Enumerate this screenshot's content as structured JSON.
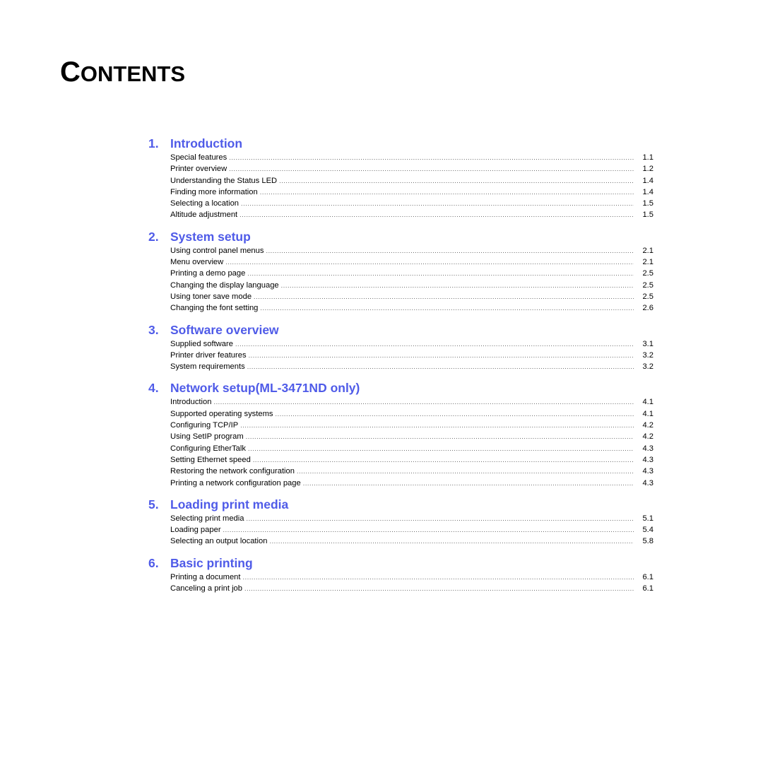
{
  "title": {
    "first_letter": "C",
    "rest": "ONTENTS"
  },
  "colors": {
    "section_heading": "#4f5be8",
    "text": "#000000"
  },
  "sections": [
    {
      "number": "1.",
      "title": "Introduction",
      "entries": [
        {
          "label": "Special features",
          "page": "1.1"
        },
        {
          "label": "Printer overview",
          "page": "1.2"
        },
        {
          "label": "Understanding the Status LED",
          "page": "1.4"
        },
        {
          "label": "Finding more information",
          "page": "1.4"
        },
        {
          "label": "Selecting a location",
          "page": "1.5"
        },
        {
          "label": "Altitude adjustment",
          "page": "1.5"
        }
      ]
    },
    {
      "number": "2.",
      "title": "System setup",
      "entries": [
        {
          "label": "Using control panel menus",
          "page": "2.1"
        },
        {
          "label": "Menu overview",
          "page": "2.1"
        },
        {
          "label": "Printing a demo page",
          "page": "2.5"
        },
        {
          "label": "Changing the display language",
          "page": "2.5"
        },
        {
          "label": "Using toner save mode",
          "page": "2.5"
        },
        {
          "label": "Changing the font setting",
          "page": "2.6"
        }
      ]
    },
    {
      "number": "3.",
      "title": "Software overview",
      "entries": [
        {
          "label": "Supplied software",
          "page": "3.1"
        },
        {
          "label": "Printer driver features",
          "page": "3.2"
        },
        {
          "label": "System requirements",
          "page": "3.2"
        }
      ]
    },
    {
      "number": "4.",
      "title": "Network setup(ML-3471ND only)",
      "entries": [
        {
          "label": "Introduction",
          "page": "4.1"
        },
        {
          "label": "Supported operating systems",
          "page": "4.1"
        },
        {
          "label": "Configuring TCP/IP",
          "page": "4.2"
        },
        {
          "label": "Using SetIP program",
          "page": "4.2"
        },
        {
          "label": "Configuring EtherTalk",
          "page": "4.3"
        },
        {
          "label": "Setting Ethernet speed",
          "page": "4.3"
        },
        {
          "label": "Restoring the network configuration",
          "page": "4.3"
        },
        {
          "label": "Printing a network configuration page",
          "page": "4.3"
        }
      ]
    },
    {
      "number": "5.",
      "title": "Loading print media",
      "entries": [
        {
          "label": "Selecting print media",
          "page": "5.1"
        },
        {
          "label": "Loading paper",
          "page": "5.4"
        },
        {
          "label": "Selecting an output location",
          "page": "5.8"
        }
      ]
    },
    {
      "number": "6.",
      "title": "Basic printing",
      "entries": [
        {
          "label": "Printing a document",
          "page": "6.1"
        },
        {
          "label": "Canceling a print job",
          "page": "6.1"
        }
      ]
    }
  ]
}
